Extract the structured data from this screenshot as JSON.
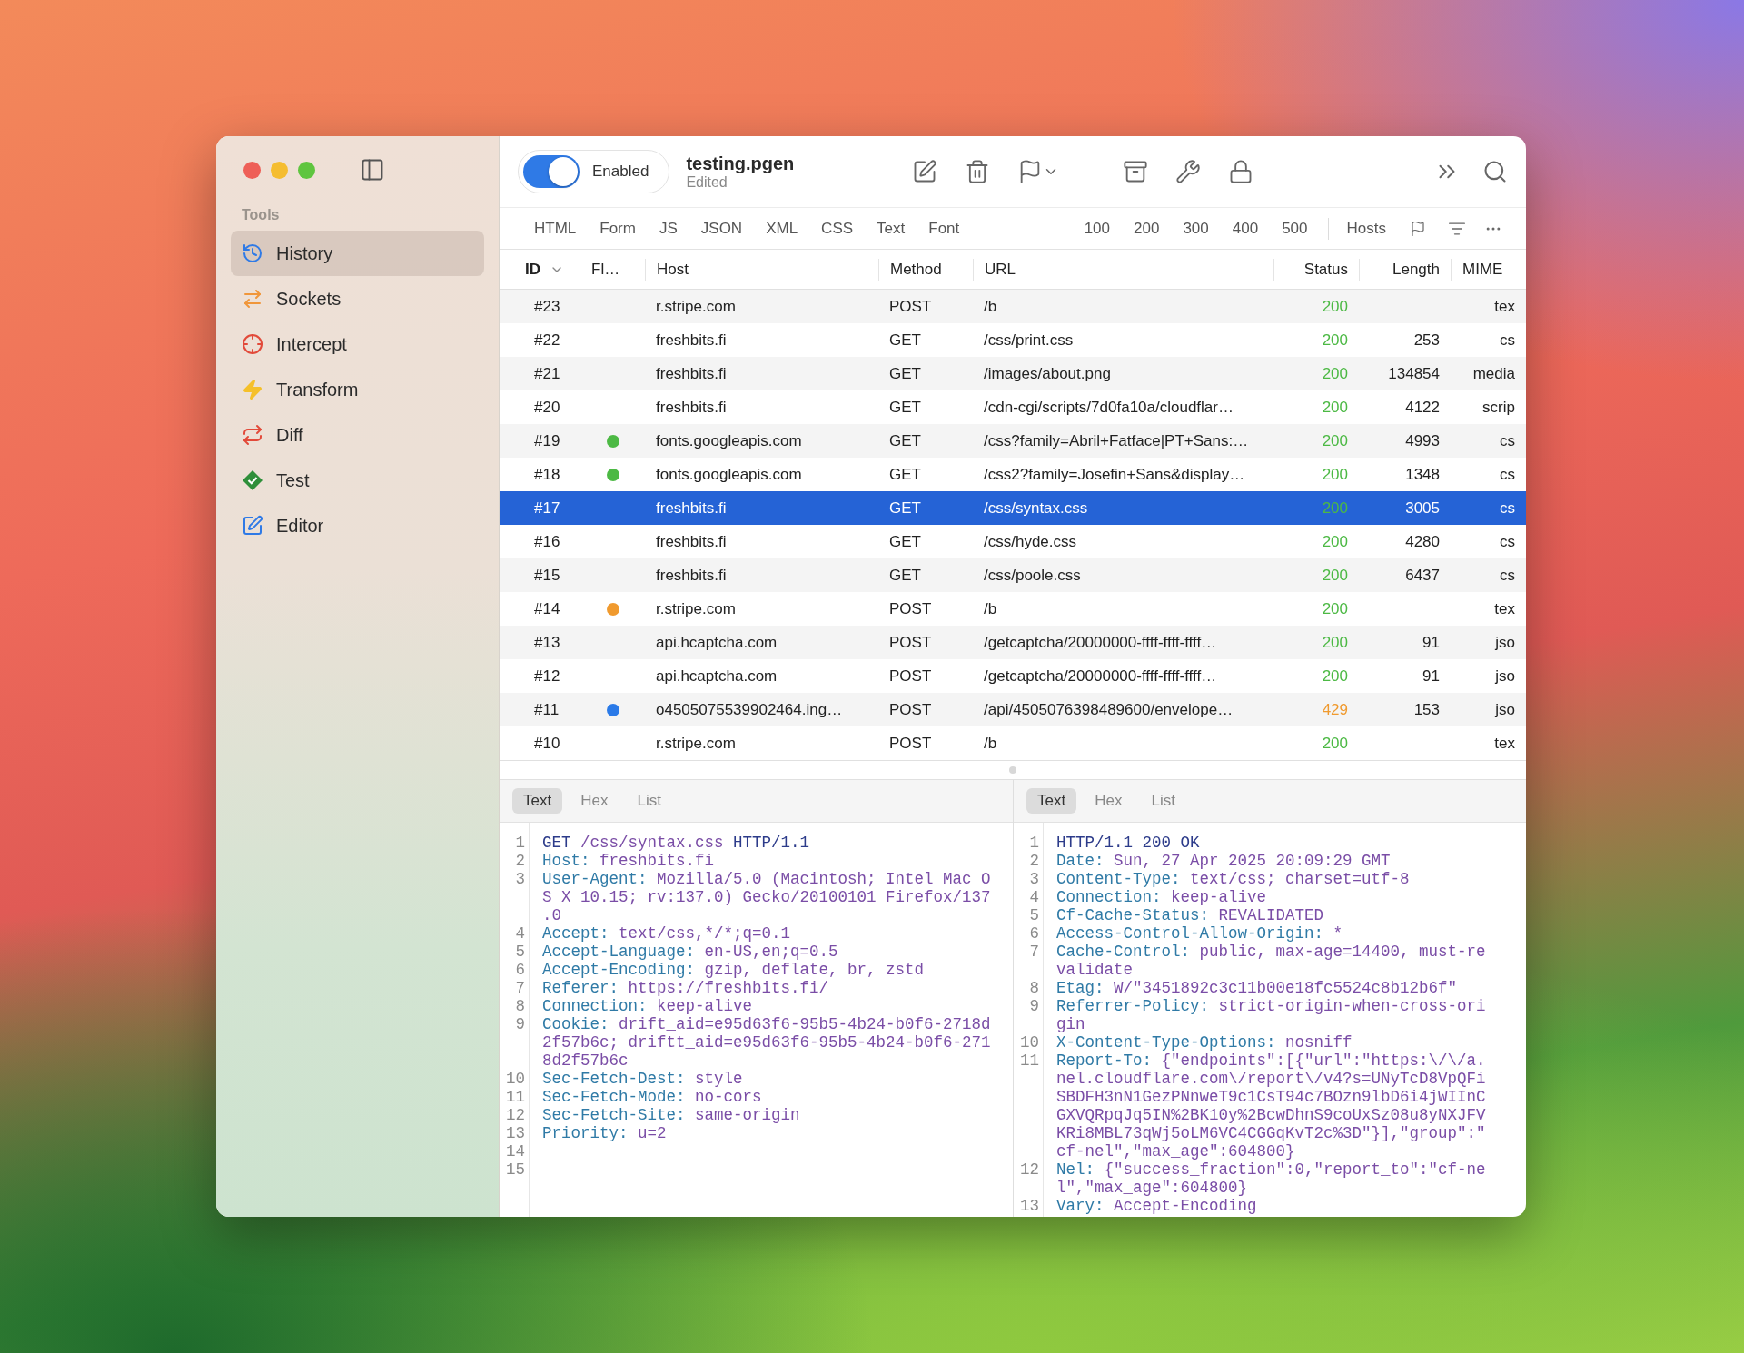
{
  "sidebar": {
    "section": "Tools",
    "items": [
      {
        "label": "History",
        "selected": true
      },
      {
        "label": "Sockets",
        "selected": false
      },
      {
        "label": "Intercept",
        "selected": false
      },
      {
        "label": "Transform",
        "selected": false
      },
      {
        "label": "Diff",
        "selected": false
      },
      {
        "label": "Test",
        "selected": false
      },
      {
        "label": "Editor",
        "selected": false
      }
    ]
  },
  "toolbar": {
    "toggle": {
      "label": "Enabled",
      "on": true
    },
    "title": "testing.pgen",
    "subtitle": "Edited"
  },
  "filters": {
    "content_types": [
      "HTML",
      "Form",
      "JS",
      "JSON",
      "XML",
      "CSS",
      "Text",
      "Font"
    ],
    "status_codes": [
      "100",
      "200",
      "300",
      "400",
      "500"
    ],
    "hosts": "Hosts"
  },
  "table": {
    "columns": [
      "ID",
      "Fl…",
      "Host",
      "Method",
      "URL",
      "Status",
      "Length",
      "MIME"
    ],
    "rows": [
      {
        "id": "#23",
        "host": "r.stripe.com",
        "method": "POST",
        "url": "/b",
        "status": {
          "text": "200",
          "color": "#4cb944"
        },
        "length": "",
        "mime": "tex",
        "selected": false
      },
      {
        "id": "#22",
        "host": "freshbits.fi",
        "method": "GET",
        "url": "/css/print.css",
        "status": {
          "text": "200",
          "color": "#4cb944"
        },
        "length": "253",
        "mime": "cs",
        "selected": false
      },
      {
        "id": "#21",
        "host": "freshbits.fi",
        "method": "GET",
        "url": "/images/about.png",
        "status": {
          "text": "200",
          "color": "#4cb944"
        },
        "length": "134854",
        "mime": "media",
        "selected": false
      },
      {
        "id": "#20",
        "host": "freshbits.fi",
        "method": "GET",
        "url": "/cdn-cgi/scripts/7d0fa10a/cloudflar…",
        "status": {
          "text": "200",
          "color": "#4cb944"
        },
        "length": "4122",
        "mime": "scrip",
        "selected": false
      },
      {
        "id": "#19",
        "color": "#4cb944",
        "host": "fonts.googleapis.com",
        "method": "GET",
        "url": "/css?family=Abril+Fatface|PT+Sans:…",
        "status": {
          "text": "200",
          "color": "#4cb944"
        },
        "length": "4993",
        "mime": "cs",
        "selected": false
      },
      {
        "id": "#18",
        "color": "#4cb944",
        "host": "fonts.googleapis.com",
        "method": "GET",
        "url": "/css2?family=Josefin+Sans&display…",
        "status": {
          "text": "200",
          "color": "#4cb944"
        },
        "length": "1348",
        "mime": "cs",
        "selected": false
      },
      {
        "id": "#17",
        "host": "freshbits.fi",
        "method": "GET",
        "url": "/css/syntax.css",
        "status": {
          "text": "200",
          "color": "#4cb944"
        },
        "length": "3005",
        "mime": "cs",
        "selected": true
      },
      {
        "id": "#16",
        "host": "freshbits.fi",
        "method": "GET",
        "url": "/css/hyde.css",
        "status": {
          "text": "200",
          "color": "#4cb944"
        },
        "length": "4280",
        "mime": "cs",
        "selected": false
      },
      {
        "id": "#15",
        "host": "freshbits.fi",
        "method": "GET",
        "url": "/css/poole.css",
        "status": {
          "text": "200",
          "color": "#4cb944"
        },
        "length": "6437",
        "mime": "cs",
        "selected": false
      },
      {
        "id": "#14",
        "color": "#f09a2e",
        "host": "r.stripe.com",
        "method": "POST",
        "url": "/b",
        "status": {
          "text": "200",
          "color": "#4cb944"
        },
        "length": "",
        "mime": "tex",
        "selected": false
      },
      {
        "id": "#13",
        "host": "api.hcaptcha.com",
        "method": "POST",
        "url": "/getcaptcha/20000000-ffff-ffff-ffff…",
        "status": {
          "text": "200",
          "color": "#4cb944"
        },
        "length": "91",
        "mime": "jso",
        "selected": false
      },
      {
        "id": "#12",
        "host": "api.hcaptcha.com",
        "method": "POST",
        "url": "/getcaptcha/20000000-ffff-ffff-ffff…",
        "status": {
          "text": "200",
          "color": "#4cb944"
        },
        "length": "91",
        "mime": "jso",
        "selected": false
      },
      {
        "id": "#11",
        "color": "#2a7ae8",
        "host": "o4505075539902464.ing…",
        "method": "POST",
        "url": "/api/4505076398489600/envelope…",
        "status": {
          "text": "429",
          "color": "#f09a2e"
        },
        "length": "153",
        "mime": "jso",
        "selected": false
      },
      {
        "id": "#10",
        "host": "r.stripe.com",
        "method": "POST",
        "url": "/b",
        "status": {
          "text": "200",
          "color": "#4cb944"
        },
        "length": "",
        "mime": "tex",
        "selected": false
      }
    ]
  },
  "request": {
    "tabs": [
      {
        "label": "Text",
        "selected": true
      },
      {
        "label": "Hex",
        "selected": false
      },
      {
        "label": "List",
        "selected": false
      }
    ],
    "lines": [
      {
        "number": "1",
        "kind": "start",
        "method": "GET",
        "path": "/css/syntax.css",
        "version": "HTTP/1.1"
      },
      {
        "number": "2",
        "kind": "header",
        "name": "Host:",
        "value": "freshbits.fi"
      },
      {
        "number": "3",
        "kind": "header",
        "name": "User-Agent:",
        "value": "Mozilla/5.0 (Macintosh; Intel Mac OS X 10.15; rv:137.0) Gecko/20100101 Firefox/137.0"
      },
      {
        "number": "4",
        "kind": "header",
        "name": "Accept:",
        "value": "text/css,*/*;q=0.1"
      },
      {
        "number": "5",
        "kind": "header",
        "name": "Accept-Language:",
        "value": "en-US,en;q=0.5"
      },
      {
        "number": "6",
        "kind": "header",
        "name": "Accept-Encoding:",
        "value": "gzip, deflate, br, zstd"
      },
      {
        "number": "7",
        "kind": "header",
        "name": "Referer:",
        "value": "https://freshbits.fi/"
      },
      {
        "number": "8",
        "kind": "header",
        "name": "Connection:",
        "value": "keep-alive"
      },
      {
        "number": "9",
        "kind": "header",
        "name": "Cookie:",
        "value": "drift_aid=e95d63f6-95b5-4b24-b0f6-2718d2f57b6c; driftt_aid=e95d63f6-95b5-4b24-b0f6-2718d2f57b6c"
      },
      {
        "number": "10",
        "kind": "header",
        "name": "Sec-Fetch-Dest:",
        "value": "style"
      },
      {
        "number": "11",
        "kind": "header",
        "name": "Sec-Fetch-Mode:",
        "value": "no-cors"
      },
      {
        "number": "12",
        "kind": "header",
        "name": "Sec-Fetch-Site:",
        "value": "same-origin"
      },
      {
        "number": "13",
        "kind": "header",
        "name": "Priority:",
        "value": "u=2"
      },
      {
        "number": "14",
        "kind": "empty"
      },
      {
        "number": "15",
        "kind": "empty"
      }
    ]
  },
  "response": {
    "tabs": [
      {
        "label": "Text",
        "selected": true
      },
      {
        "label": "Hex",
        "selected": false
      },
      {
        "label": "List",
        "selected": false
      }
    ],
    "lines": [
      {
        "number": "1",
        "kind": "status",
        "text": "HTTP/1.1 200 OK"
      },
      {
        "number": "2",
        "kind": "header",
        "name": "Date:",
        "value": "Sun, 27 Apr 2025 20:09:29 GMT"
      },
      {
        "number": "3",
        "kind": "header",
        "name": "Content-Type:",
        "value": "text/css; charset=utf-8"
      },
      {
        "number": "4",
        "kind": "header",
        "name": "Connection:",
        "value": "keep-alive"
      },
      {
        "number": "5",
        "kind": "header",
        "name": "Cf-Cache-Status:",
        "value": "REVALIDATED"
      },
      {
        "number": "6",
        "kind": "header",
        "name": "Access-Control-Allow-Origin:",
        "value": "*"
      },
      {
        "number": "7",
        "kind": "header",
        "name": "Cache-Control:",
        "value": "public, max-age=14400, must-revalidate"
      },
      {
        "number": "8",
        "kind": "header",
        "name": "Etag:",
        "value": "W/\"3451892c3c11b00e18fc5524c8b12b6f\""
      },
      {
        "number": "9",
        "kind": "header",
        "name": "Referrer-Policy:",
        "value": "strict-origin-when-cross-origin"
      },
      {
        "number": "10",
        "kind": "header",
        "name": "X-Content-Type-Options:",
        "value": "nosniff"
      },
      {
        "number": "11",
        "kind": "header",
        "name": "Report-To:",
        "value": "{\"endpoints\":[{\"url\":\"https:\\/\\/a.nel.cloudflare.com\\/report\\/v4?s=UNyTcD8VpQFiSBDFH3nN1GezPNnweT9c1CsT94c7BOzn9lbD6i4jWIInCGXVQRpqJq5IN%2BK10y%2BcwDhnS9coUxSz08u8yNXJFVKRi8MBL73qWj5oLM6VC4CGGqKvT2c%3D\"}],\"group\":\"cf-nel\",\"max_age\":604800}"
      },
      {
        "number": "12",
        "kind": "header",
        "name": "Nel:",
        "value": "{\"success_fraction\":0,\"report_to\":\"cf-nel\",\"max_age\":604800}"
      },
      {
        "number": "13",
        "kind": "header",
        "name": "Vary:",
        "value": "Accept-Encoding"
      }
    ]
  }
}
